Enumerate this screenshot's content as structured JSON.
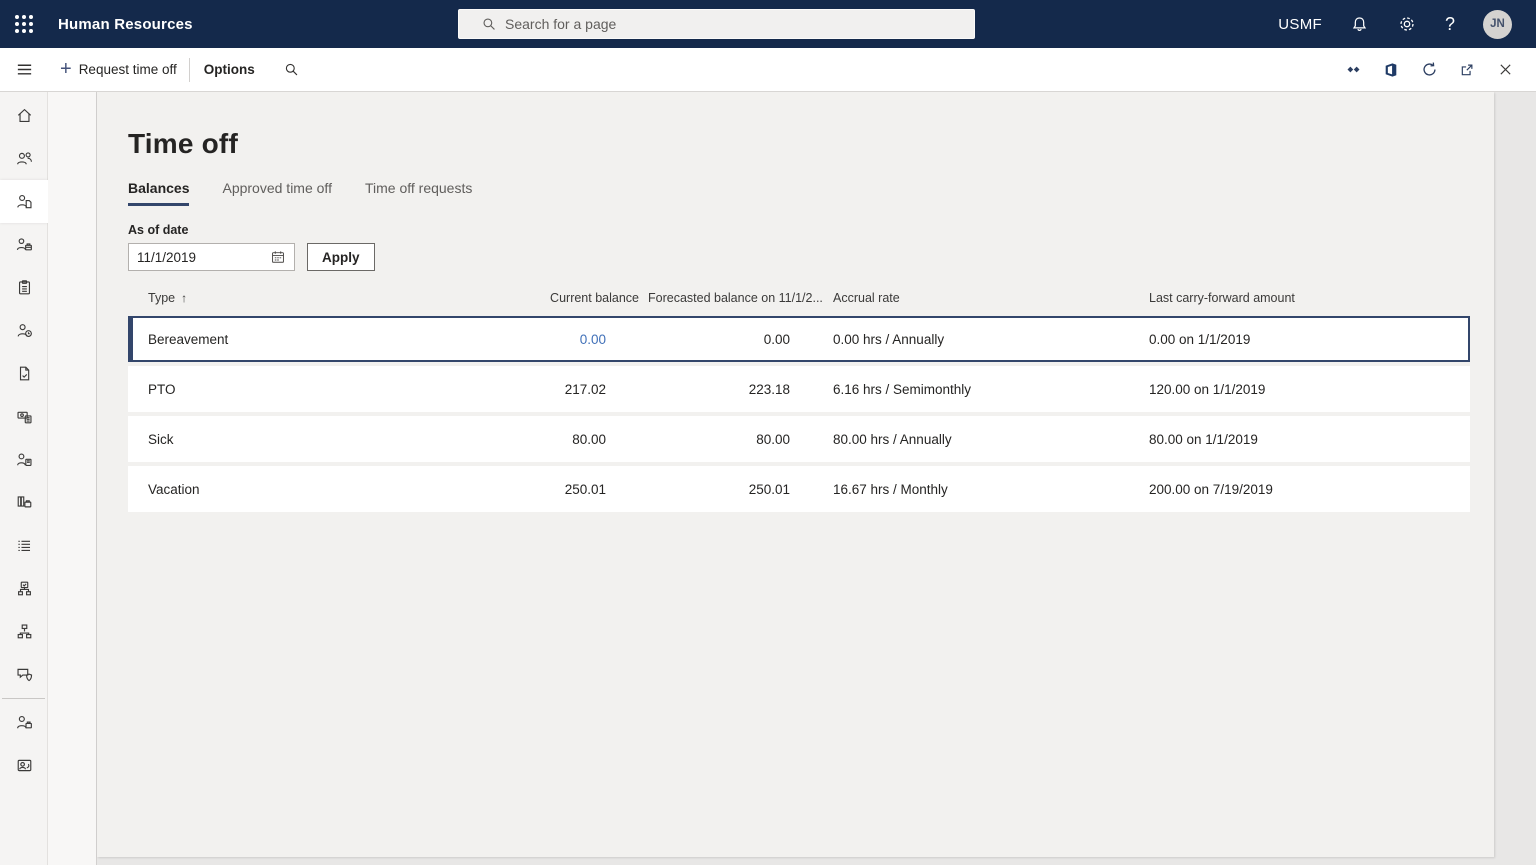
{
  "colors": {
    "topbar_bg": "#14294b",
    "accent": "#33466b",
    "link": "#4070b8",
    "selected_border": "#33466b"
  },
  "topbar": {
    "app_title": "Human Resources",
    "search_placeholder": "Search for a page",
    "company": "USMF",
    "avatar_initials": "JN",
    "icons": [
      "waffle-icon",
      "search-icon",
      "bell-icon",
      "gear-icon",
      "help-icon",
      "avatar"
    ]
  },
  "action_bar": {
    "new_label": "Request time off",
    "options_label": "Options",
    "left_icons": [
      "menu-icon",
      "plus-icon",
      "search-icon"
    ],
    "right_icons": [
      "personalize-icon",
      "office-icon",
      "refresh-icon",
      "popout-icon",
      "close-icon"
    ]
  },
  "sidebar": {
    "icons": [
      "home",
      "people",
      "person-document",
      "people-briefcase",
      "clipboard",
      "person-clock",
      "document-check",
      "payroll-calculator",
      "person-kiosk",
      "books-briefcase",
      "list",
      "task-boxes",
      "org-chart",
      "feedback-shield",
      "person-briefcase",
      "employee-badge"
    ],
    "selected_index": 2
  },
  "page": {
    "title": "Time off",
    "tabs": [
      {
        "label": "Balances",
        "active": true
      },
      {
        "label": "Approved time off",
        "active": false
      },
      {
        "label": "Time off requests",
        "active": false
      }
    ],
    "as_of_date_label": "As of date",
    "as_of_date_value": "11/1/2019",
    "apply_label": "Apply",
    "sort_indicator": "↑"
  },
  "table": {
    "columns": {
      "type": "Type",
      "current": "Current balance",
      "forecast": "Forecasted balance on 11/1/2...",
      "accrual": "Accrual rate",
      "carry": "Last carry-forward amount"
    },
    "rows": [
      {
        "type": "Bereavement",
        "current": "0.00",
        "forecast": "0.00",
        "accrual": "0.00 hrs / Annually",
        "carry": "0.00 on 1/1/2019",
        "selected": true
      },
      {
        "type": "PTO",
        "current": "217.02",
        "forecast": "223.18",
        "accrual": "6.16 hrs / Semimonthly",
        "carry": "120.00 on 1/1/2019",
        "selected": false
      },
      {
        "type": "Sick",
        "current": "80.00",
        "forecast": "80.00",
        "accrual": "80.00 hrs / Annually",
        "carry": "80.00 on 1/1/2019",
        "selected": false
      },
      {
        "type": "Vacation",
        "current": "250.01",
        "forecast": "250.01",
        "accrual": "16.67 hrs / Monthly",
        "carry": "200.00 on 7/19/2019",
        "selected": false
      }
    ]
  }
}
